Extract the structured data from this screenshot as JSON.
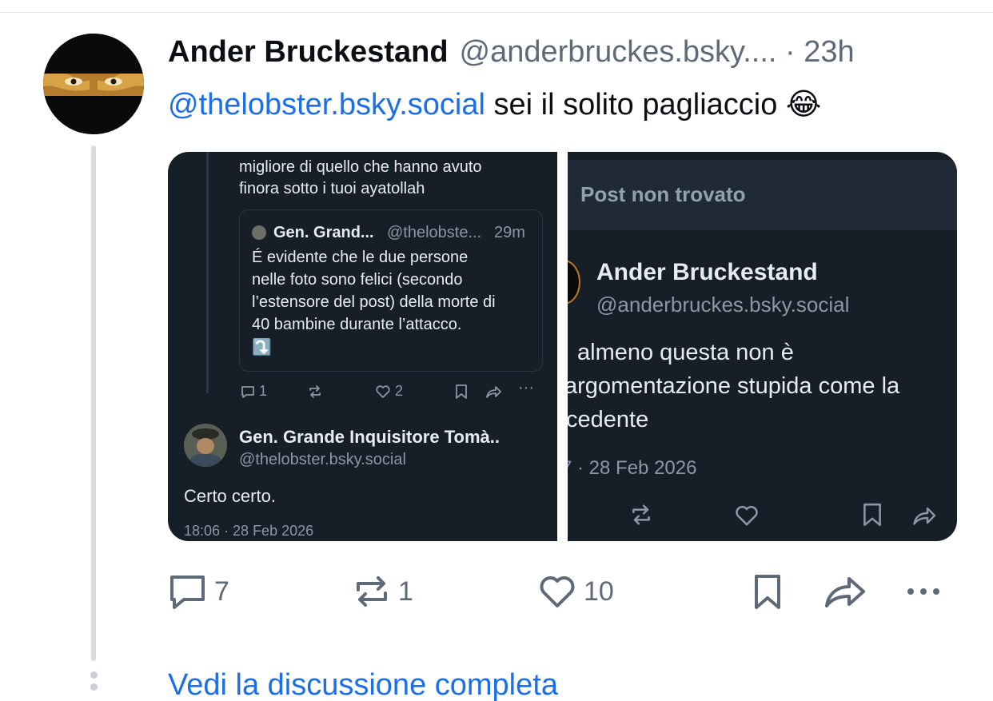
{
  "post": {
    "author_name": "Ander Bruckestand",
    "author_handle": "@anderbruckes.bsky....",
    "time": "· 23h",
    "mention": "@thelobster.bsky.social",
    "text": "sei il solito pagliaccio",
    "emoji": "😂"
  },
  "embed_left": {
    "line1": "migliore di quello che hanno avuto",
    "line2": "finora sotto i tuoi ayatollah",
    "quote_author": "Gen. Grand...",
    "quote_handle": "@thelobste...",
    "quote_time": "29m",
    "quote_lines": [
      "É evidente che le due persone",
      "nelle foto sono felici (secondo",
      "l’estensore del post) della morte di",
      "40 bambine durante l’attacco."
    ],
    "quote_emoji": "⤵️",
    "reply_count": "1",
    "like_count": "2",
    "reply_author": "Gen. Grande Inquisitore Tomà..",
    "reply_handle": "@thelobster.bsky.social",
    "reply_text": "Certo certo.",
    "reply_timestamp": "18:06 · 28 Feb 2026"
  },
  "embed_right": {
    "header": "Post non trovato",
    "author": "Ander Bruckestand",
    "handle": "@anderbruckes.bsky.social",
    "line1": "almeno questa non è",
    "line2": "argomentazione stupida come la",
    "line3": "cedente",
    "timestamp": "7 · 28 Feb 2026"
  },
  "actions": {
    "replies": "7",
    "reposts": "1",
    "likes": "10"
  },
  "see_thread": "Vedi la discussione completa",
  "colors": {
    "link": "#1c6fe8",
    "muted": "#5e6a78",
    "dark_bg": "#161e27"
  }
}
